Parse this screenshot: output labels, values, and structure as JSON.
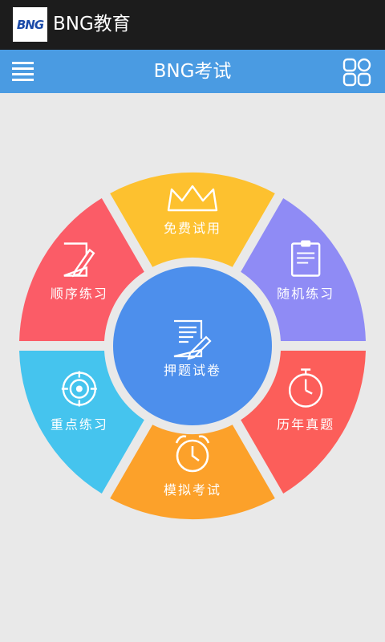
{
  "app": {
    "title": "BNG教育",
    "logo": "BNG"
  },
  "navbar": {
    "title": "BNG考试",
    "menu_icon": "menu-icon",
    "grid_icon": "grid-icon"
  },
  "wheel": {
    "segments": [
      {
        "label": "免费试用",
        "icon": "crown-icon",
        "color": "#fdc12f"
      },
      {
        "label": "随机练习",
        "icon": "clipboard-icon",
        "color": "#8f8bf5"
      },
      {
        "label": "历年真题",
        "icon": "stopwatch-icon",
        "color": "#fc5e5a"
      },
      {
        "label": "模拟考试",
        "icon": "alarm-clock-icon",
        "color": "#fca12a"
      },
      {
        "label": "重点练习",
        "icon": "target-icon",
        "color": "#45c4ee"
      },
      {
        "label": "顺序练习",
        "icon": "edit-note-icon",
        "color": "#fb5c67"
      }
    ],
    "center": {
      "label": "押题试卷",
      "icon": "document-edit-icon",
      "color": "#4d8fec"
    }
  }
}
